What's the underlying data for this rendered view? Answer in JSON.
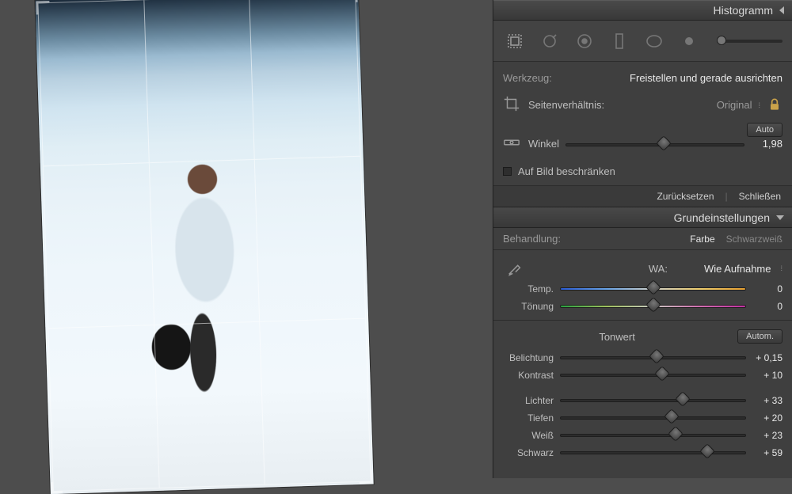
{
  "header": {
    "histogram": "Histogramm"
  },
  "tool": {
    "label": "Werkzeug:",
    "name": "Freistellen und gerade ausrichten",
    "aspect_label": "Seitenverhältnis:",
    "aspect_value": "Original",
    "angle_label": "Winkel",
    "angle_auto": "Auto",
    "angle_value": "1,98",
    "angle_pct": 55,
    "constrain_label": "Auf Bild beschränken",
    "constrain_checked": false,
    "reset": "Zurücksetzen",
    "close": "Schließen"
  },
  "basic": {
    "header": "Grundeinstellungen",
    "treatment_label": "Behandlung:",
    "treatment_color": "Farbe",
    "treatment_bw": "Schwarzweiß",
    "wb_label": "WA:",
    "wb_value": "Wie Aufnahme",
    "temp": {
      "name": "Temp.",
      "value": "0",
      "pct": 50
    },
    "tint": {
      "name": "Tönung",
      "value": "0",
      "pct": 50
    },
    "tone_label": "Tonwert",
    "tone_auto": "Autom.",
    "exposure": {
      "name": "Belichtung",
      "value": "+ 0,15",
      "pct": 52
    },
    "contrast": {
      "name": "Kontrast",
      "value": "+ 10",
      "pct": 55
    },
    "highlights": {
      "name": "Lichter",
      "value": "+ 33",
      "pct": 66
    },
    "shadows": {
      "name": "Tiefen",
      "value": "+ 20",
      "pct": 60
    },
    "whites": {
      "name": "Weiß",
      "value": "+ 23",
      "pct": 62
    },
    "blacks": {
      "name": "Schwarz",
      "value": "+ 59",
      "pct": 79
    }
  }
}
